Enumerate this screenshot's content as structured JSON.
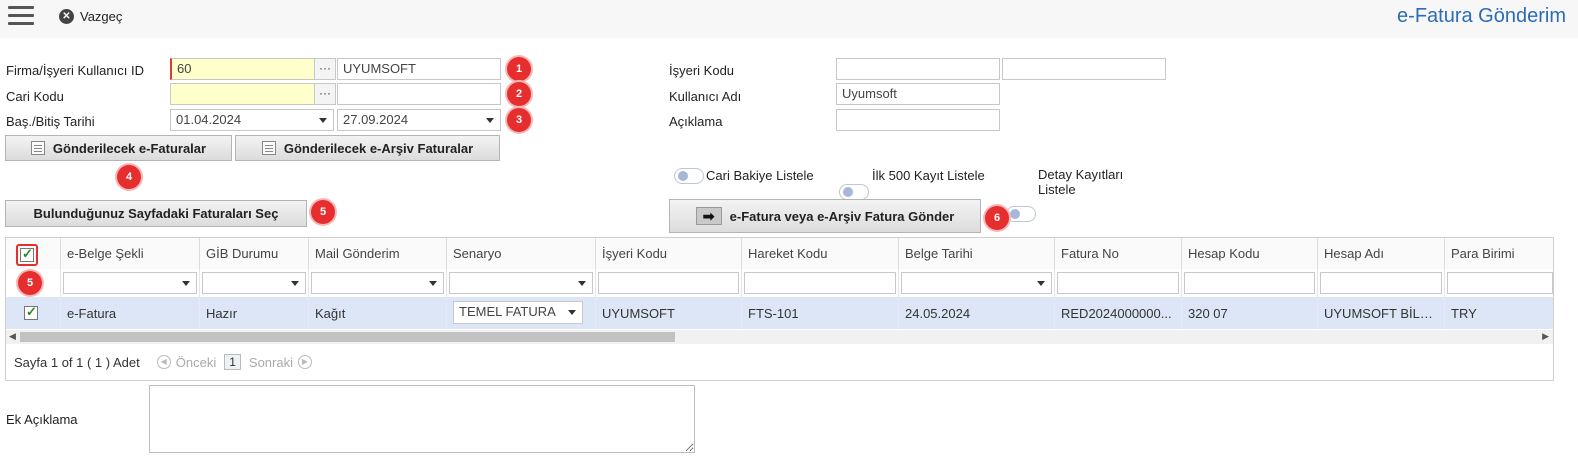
{
  "header": {
    "close_label": "Vazgeç",
    "title": "e-Fatura Gönderim"
  },
  "form": {
    "firma_label": "Firma/İşyeri Kullanıcı ID",
    "firma_value": "60",
    "firma_name": "UYUMSOFT",
    "cari_label": "Cari Kodu",
    "cari_value": "",
    "cari_name": "",
    "tarih_label": "Baş./Bitiş Tarihi",
    "start_date": "01.04.2024",
    "end_date": "27.09.2024",
    "isyeri_label": "İşyeri Kodu",
    "kullanici_label": "Kullanıcı Adı",
    "kullanici_value": "Uyumsoft",
    "aciklama_label": "Açıklama",
    "ellipsis": "···"
  },
  "buttons": {
    "efatura": "Gönderilecek e-Faturalar",
    "earsiv": "Gönderilecek e-Arşiv Faturalar",
    "select_page": "Bulunduğunuz Sayfadaki Faturaları Seç",
    "send": "e-Fatura veya e-Arşiv Fatura Gönder"
  },
  "toggles": {
    "cari_bakiye": "Cari Bakiye Listele",
    "ilk_500": "İlk 500 Kayıt Listele",
    "detay": "Detay Kayıtları Listele"
  },
  "badges": [
    "1",
    "2",
    "3",
    "4",
    "5",
    "6",
    "5"
  ],
  "grid": {
    "columns": [
      "e-Belge Şekli",
      "GİB Durumu",
      "Mail Gönderim",
      "Senaryo",
      "İşyeri Kodu",
      "Hareket Kodu",
      "Belge Tarihi",
      "Fatura No",
      "Hesap Kodu",
      "Hesap Adı",
      "Para Birimi"
    ],
    "row": {
      "e_belge": "e-Fatura",
      "gib": "Hazır",
      "mail": "Kağıt",
      "senaryo": "TEMEL FATURA",
      "isyeri": "UYUMSOFT",
      "hareket": "FTS-101",
      "tarih": "24.05.2024",
      "fatura_no": "RED2024000000...",
      "hesap_kodu": "320 07",
      "hesap_adi": "UYUMSOFT BİLG...",
      "para": "TRY"
    }
  },
  "pager": {
    "summary": "Sayfa 1 of 1 ( 1 ) Adet",
    "prev": "Önceki",
    "page": "1",
    "next": "Sonraki"
  },
  "ek_aciklama_label": "Ek Açıklama",
  "colors": {
    "accent": "#2b6cb8",
    "badge": "#e62e2e",
    "selected_row": "#dde6f6",
    "required_input": "#ffffcc"
  }
}
